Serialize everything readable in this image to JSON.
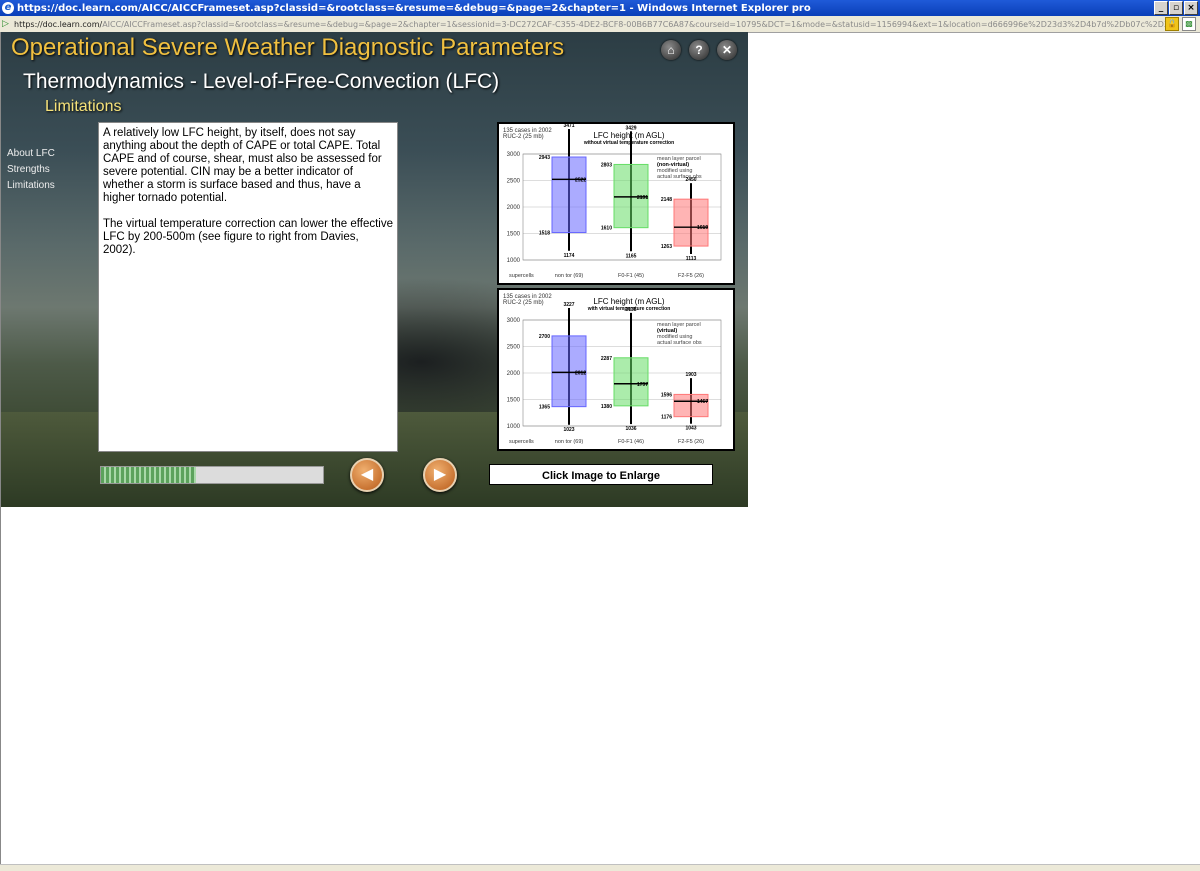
{
  "window": {
    "title": "https://doc.learn.com/AICC/AICCFrameset.asp?classid=&rootclass=&resume=&debug=&page=2&chapter=1 - Windows Internet Explorer pro",
    "url_host": "https://doc.learn.com/",
    "url_rest": "AICC/AICCFrameset.asp?classid=&rootclass=&resume=&debug=&page=2&chapter=1&sessionid=3-DC272CAF-C355-4DE2-BCF8-00B6B77C6A87&courseid=10795&DCT=1&mode=&statusid=1156994&ext=1&location=d666996e%2D23d3%2D4b7d%2Db07c%2D3296dd4566f0",
    "min": "_",
    "max": "▫",
    "close": "×"
  },
  "lesson": {
    "main_title": "Operational Severe Weather Diagnostic Parameters",
    "subtitle": "Thermodynamics - Level-of-Free-Convection (LFC)",
    "section": "Limitations",
    "icons": {
      "home": "home-icon",
      "help": "help-icon",
      "close": "close-icon"
    }
  },
  "sidenav": {
    "items": [
      {
        "label": "About LFC"
      },
      {
        "label": "Strengths"
      },
      {
        "label": "Limitations"
      }
    ]
  },
  "content": {
    "para1": "A relatively low LFC height, by itself, does not say anything about the depth of CAPE or total CAPE. Total CAPE and of course, shear, must also be assessed for severe potential. CIN may be a better indicator of whether a storm is surface based and thus, have a higher tornado potential.",
    "para2": "The virtual temperature correction can lower the effective LFC by 200-500m (see figure to right from Davies, 2002)."
  },
  "progress": {
    "fraction": 0.43
  },
  "buttons": {
    "enlarge": "Click Image to Enlarge",
    "prev": "◀",
    "next": "▶"
  },
  "chart_data": [
    {
      "type": "box",
      "title": "LFC height (m AGL)",
      "subtitle": "without virtual temperature correction",
      "note_cases": "135 cases in 2002",
      "note_model": "RUC-2 (25 mb)",
      "legend_text": [
        "mean layer parcel",
        "(non-virtual)",
        "modified using",
        "actual surface obs"
      ],
      "ylim": [
        1000,
        3000
      ],
      "yticks": [
        1000,
        1500,
        2000,
        2500,
        3000
      ],
      "categories": [
        "non tor (69)",
        "F0-F1 (45)",
        "F2-F5 (26)"
      ],
      "x_prefix": "supercells",
      "colors": [
        "#6666ff",
        "#66dd66",
        "#ff7777"
      ],
      "boxes": [
        {
          "max": 3471,
          "q3": 2943,
          "median": 2522,
          "q1": 1518,
          "min": 1174
        },
        {
          "max": 3429,
          "q3": 2803,
          "median": 2191,
          "q1": 1610,
          "min": 1165
        },
        {
          "max": 2450,
          "q3": 2148,
          "median": 1619,
          "q1": 1263,
          "min": 1113
        }
      ]
    },
    {
      "type": "box",
      "title": "LFC height (m AGL)",
      "subtitle": "with virtual temperature correction",
      "note_cases": "135 cases in 2002",
      "note_model": "RUC-2 (25 mb)",
      "legend_text": [
        "mean layer parcel",
        "(virtual)",
        "modified using",
        "actual surface obs"
      ],
      "ylim": [
        1000,
        3000
      ],
      "yticks": [
        1000,
        1500,
        2000,
        2500,
        3000
      ],
      "categories": [
        "non tor (69)",
        "F0-F1 (46)",
        "F2-F5 (26)"
      ],
      "x_prefix": "supercells",
      "colors": [
        "#6666ff",
        "#66dd66",
        "#ff7777"
      ],
      "boxes": [
        {
          "max": 3227,
          "q3": 2700,
          "median": 2012,
          "q1": 1365,
          "min": 1023
        },
        {
          "max": 3135,
          "q3": 2287,
          "median": 1797,
          "q1": 1380,
          "min": 1036
        },
        {
          "max": 1903,
          "q3": 1596,
          "median": 1467,
          "q1": 1176,
          "min": 1043
        }
      ]
    }
  ]
}
